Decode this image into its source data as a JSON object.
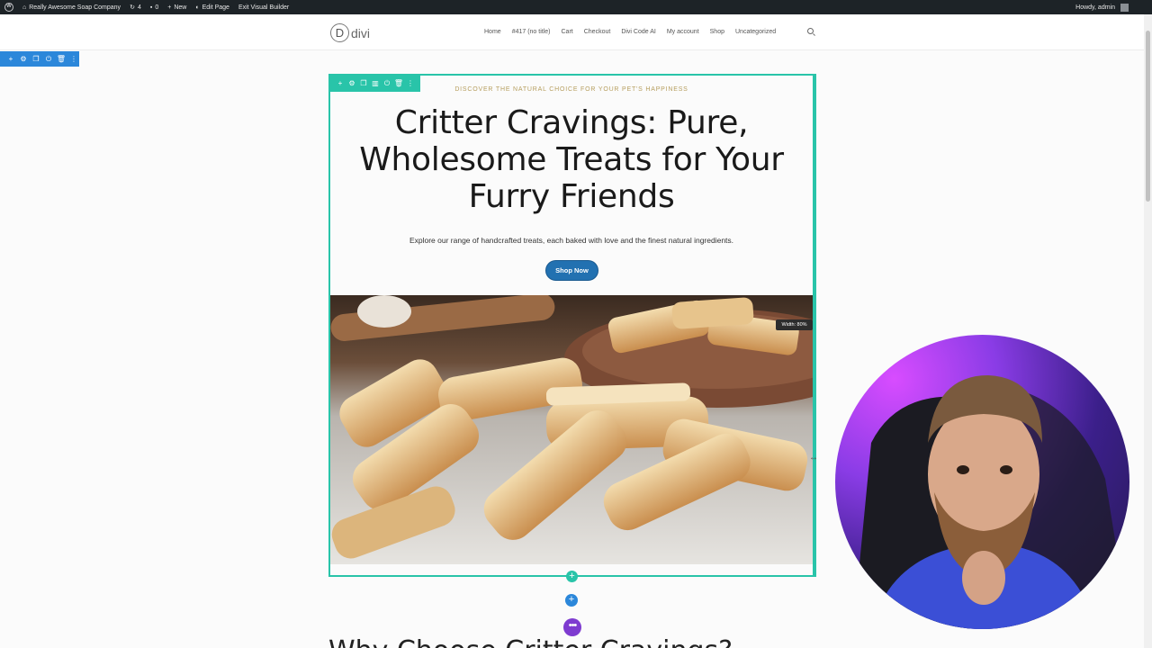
{
  "adminbar": {
    "site_name": "Really Awesome Soap Company",
    "updates_count": "4",
    "comments_count": "0",
    "new_label": "New",
    "edit_page_label": "Edit Page",
    "exit_builder_label": "Exit Visual Builder",
    "howdy_label": "Howdy, admin"
  },
  "header": {
    "logo_letter": "D",
    "logo_text": "divi",
    "nav": [
      "Home",
      "#417 (no title)",
      "Cart",
      "Checkout",
      "Divi Code AI",
      "My account",
      "Shop",
      "Uncategorized"
    ]
  },
  "hero": {
    "kicker": "DISCOVER THE NATURAL CHOICE FOR YOUR PET'S HAPPINESS",
    "headline": "Critter Cravings: Pure, Wholesome Treats for Your Furry Friends",
    "subtext": "Explore our range of handcrafted treats, each baked with love and the finest natural ingredients.",
    "button_label": "Shop Now",
    "width_badge": "Width: 80%"
  },
  "next_section": {
    "heading_partial": "Why Choose Critter Cravings?"
  },
  "colors": {
    "row_outline": "#29c4a9",
    "section_blue": "#2b87da",
    "button_blue": "#2271b1",
    "purple": "#7e3bd0",
    "kicker_gold": "#b69e5e"
  },
  "icons": {
    "section_toolbar": [
      "plus-icon",
      "gear-icon",
      "duplicate-icon",
      "power-icon",
      "trash-icon",
      "more-vertical-icon"
    ],
    "row_toolbar": [
      "plus-icon",
      "gear-icon",
      "duplicate-icon",
      "columns-icon",
      "power-icon",
      "trash-icon",
      "more-vertical-icon"
    ]
  }
}
